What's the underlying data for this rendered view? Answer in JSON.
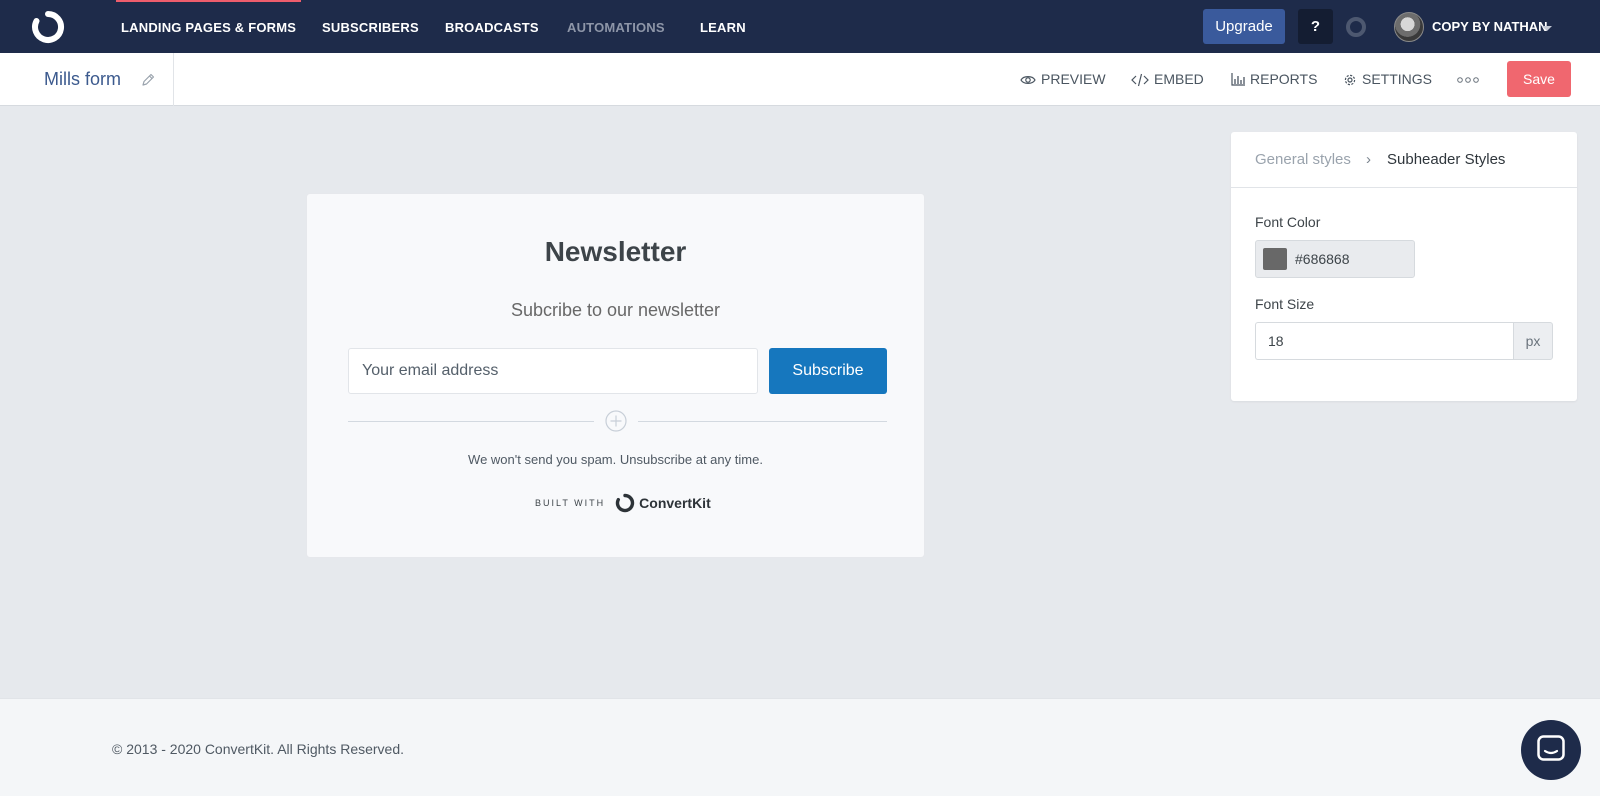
{
  "nav": {
    "items": [
      {
        "label": "LANDING PAGES & FORMS"
      },
      {
        "label": "SUBSCRIBERS"
      },
      {
        "label": "BROADCASTS"
      },
      {
        "label": "AUTOMATIONS"
      },
      {
        "label": "LEARN"
      }
    ],
    "upgrade_label": "Upgrade",
    "help_label": "?",
    "account_name": "COPY BY NATHAN"
  },
  "toolbar": {
    "form_name": "Mills form",
    "preview_label": "PREVIEW",
    "embed_label": "EMBED",
    "reports_label": "REPORTS",
    "settings_label": "SETTINGS",
    "save_label": "Save"
  },
  "form": {
    "title": "Newsletter",
    "subtitle": "Subcribe to our newsletter",
    "email_placeholder": "Your email address",
    "subscribe_label": "Subscribe",
    "disclaimer": "We won't send you spam. Unsubscribe at any time.",
    "built_with_label": "BUILT WITH",
    "brand_name": "ConvertKit"
  },
  "panel": {
    "crumb_general": "General styles",
    "crumb_separator": "›",
    "crumb_current": "Subheader Styles",
    "font_color_label": "Font Color",
    "font_color_value": "#686868",
    "font_size_label": "Font Size",
    "font_size_value": "18",
    "font_size_unit": "px"
  },
  "footer": {
    "copyright": "© 2013 - 2020 ConvertKit. All Rights Reserved."
  },
  "colors": {
    "nav_bg": "#1e2b4a",
    "save": "#f0676f",
    "subscribe": "#1677be",
    "upgrade": "#3a5a9c",
    "active_indicator": "#ee5d6c"
  }
}
